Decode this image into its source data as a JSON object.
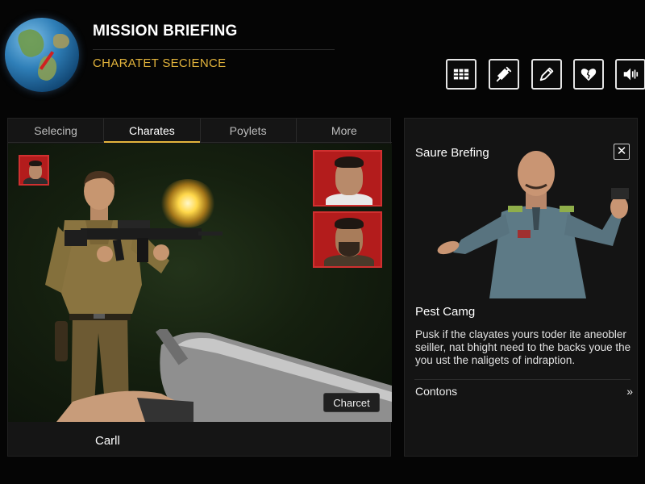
{
  "header": {
    "title": "MISSION BRIEFING",
    "subtitle": "CHARATET SECIENCE"
  },
  "toolbar": {
    "icons": [
      "grid-icon",
      "syringe-icon",
      "pen-icon",
      "heart-icon",
      "speaker-icon"
    ]
  },
  "main": {
    "tabs": [
      {
        "label": "Selecing",
        "active": false
      },
      {
        "label": "Charates",
        "active": true
      },
      {
        "label": "Poylets",
        "active": false
      },
      {
        "label": "More",
        "active": false
      }
    ],
    "scene_button": "Charcet",
    "footer_name": "Carll"
  },
  "side": {
    "title": "Saure Brefing",
    "close_glyph": "✕",
    "subtitle": "Pest Camg",
    "description": "Pusk if the clayates yours toder ite aneobler seiller, nat bhight need to the backs youe the you ust the naligets of indraption.",
    "link_label": "Contons",
    "link_glyph": "»"
  },
  "colors": {
    "accent": "#e3b43c",
    "portrait_bg": "#b31c1c",
    "panel_bg": "#151515",
    "background": "#050505"
  }
}
